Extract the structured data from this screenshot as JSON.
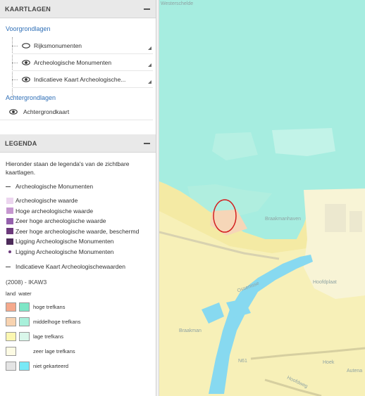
{
  "kaartlagen": {
    "title": "KAARTLAGEN",
    "voorgrond_label": "Voorgrondlagen",
    "layers": [
      {
        "label": "Rijksmonumenten",
        "visible": false
      },
      {
        "label": "Archeologische Monumenten",
        "visible": true
      },
      {
        "label": "Indicatieve Kaart Archeologische...",
        "visible": true
      }
    ],
    "achtergrond_label": "Achtergrondlagen",
    "background_layer": {
      "label": "Achtergrondkaart",
      "visible": true
    }
  },
  "legenda": {
    "title": "LEGENDA",
    "intro": "Hieronder staan de legenda's van de zichtbare kaartlagen.",
    "archeo": {
      "heading": "Archeologische Monumenten",
      "items": [
        {
          "label": "Archeologische waarde",
          "color": "#ecd5ef"
        },
        {
          "label": "Hoge archeologische waarde",
          "color": "#c697d0"
        },
        {
          "label": "Zeer hoge archeologische waarde",
          "color": "#9561ad"
        },
        {
          "label": "Zeer hoge archeologische waarde, beschermd",
          "color": "#6c3a7c"
        },
        {
          "label": "Ligging Archeologische Monumenten",
          "color": "#4d2c5a"
        },
        {
          "label": "Ligging Archeologische Monumenten",
          "color": "#6c3a7c"
        }
      ]
    },
    "ikaw": {
      "heading": "Indicatieve Kaart Archeologischewaarden",
      "subheading": "(2008) - IKAW3",
      "col_land": "land",
      "col_water": "water",
      "items": [
        {
          "label": "hoge trefkans",
          "land": "#f5a98c",
          "water": "#7ee6c6"
        },
        {
          "label": "middelhoge trefkans",
          "land": "#f8d3b0",
          "water": "#a8f0da"
        },
        {
          "label": "lage trefkans",
          "land": "#fbf7b1",
          "water": "#d9f7ea"
        },
        {
          "label": "zeer lage trefkans",
          "land": "#fdfbe4",
          "water": null
        },
        {
          "label": "niet gekarteerd",
          "land": "#e4e4e4",
          "water": "#78e9f6"
        }
      ]
    }
  },
  "map": {
    "places": [
      "Westerschelde",
      "Braakmanhaven",
      "Hoofdplaat",
      "Braakman",
      "N61",
      "Hoek",
      "Hoofdweg",
      "Ossenisse",
      "Autena"
    ]
  },
  "icons": {
    "collapse": "minus-icon",
    "eye": "eye-icon",
    "expand": "triangle-icon"
  }
}
